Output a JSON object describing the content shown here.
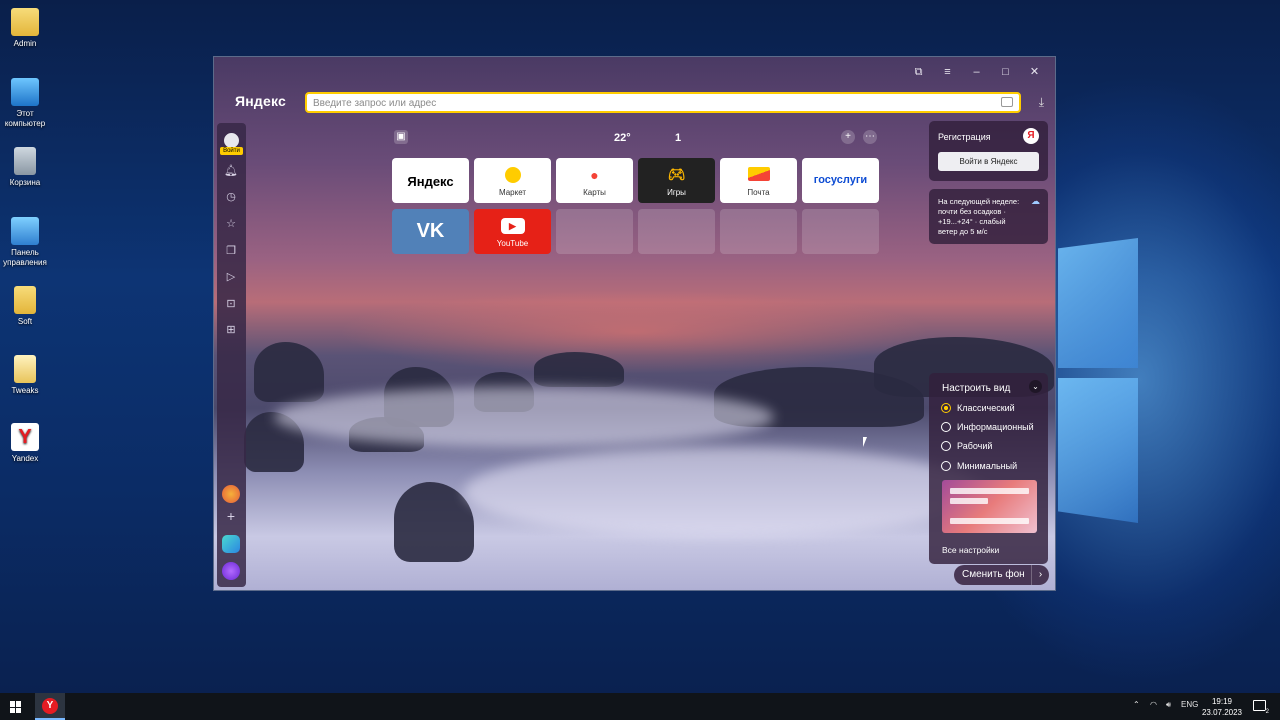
{
  "desktop": {
    "icons": [
      {
        "label": "Admin"
      },
      {
        "label": "Этот компьютер"
      },
      {
        "label": "Корзина"
      },
      {
        "label": "Панель управления"
      },
      {
        "label": "Soft"
      },
      {
        "label": "Tweaks"
      },
      {
        "label": "Yandex"
      }
    ]
  },
  "browser": {
    "logo": "Яндекс",
    "search_placeholder": "Введите запрос или адрес",
    "sidebar": {
      "login_label": "Войти"
    },
    "topbar": {
      "temperature": "22°",
      "notifications_count": "1"
    },
    "tiles": [
      {
        "name": "Яндекс",
        "label": ""
      },
      {
        "name": "Маркет",
        "label": "Маркет"
      },
      {
        "name": "Карты",
        "label": "Карты"
      },
      {
        "name": "Игры",
        "label": "Игры"
      },
      {
        "name": "Почта",
        "label": "Почта"
      },
      {
        "name": "госуслуги",
        "label": ""
      },
      {
        "name": "VK",
        "label": ""
      },
      {
        "name": "YouTube",
        "label": "YouTube"
      }
    ],
    "account_panel": {
      "title": "Регистрация",
      "login_button": "Войти в Яндекс",
      "ya_letter": "Я"
    },
    "weather_panel": {
      "text": "На следующей неделе: почти без осадков · +19...+24° · слабый ветер до 5 м/с"
    },
    "view_panel": {
      "title": "Настроить вид",
      "options": [
        "Классический",
        "Информационный",
        "Рабочий",
        "Минимальный"
      ],
      "selected": "Классический",
      "all_settings": "Все настройки"
    },
    "change_bg_button": "Сменить фон"
  },
  "taskbar": {
    "language": "ENG",
    "time": "19:19",
    "date": "23.07.2023",
    "notification_count": "2"
  },
  "colors": {
    "accent": "#ffcc00",
    "yandex_red": "#e51c23"
  }
}
